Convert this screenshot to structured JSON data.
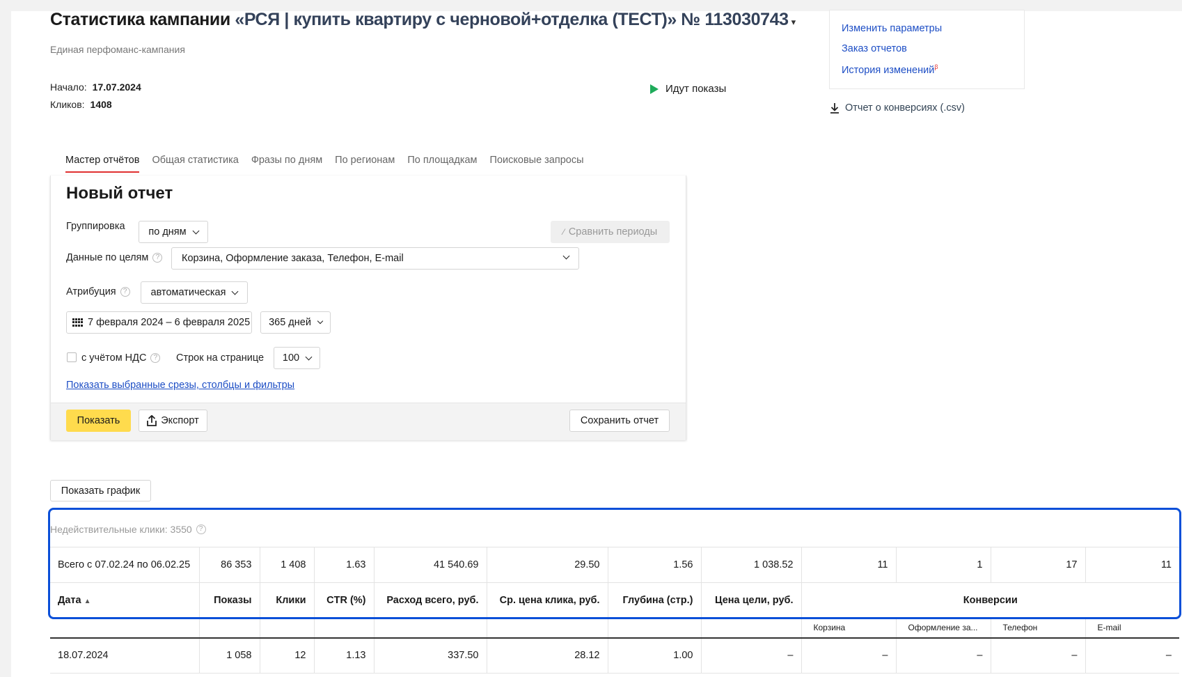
{
  "header": {
    "title_prefix": "Статистика кампании",
    "campaign_name": "«РСЯ | купить квартиру с черновой+отделка (ТЕСТ)» № 113030743",
    "caret": "▾",
    "subtitle": "Единая перфоманс-кампания",
    "start_label": "Начало:",
    "start_value": "17.07.2024",
    "clicks_label": "Кликов:",
    "clicks_value": "1408",
    "status": "Идут показы"
  },
  "side": {
    "links": [
      "Изменить параметры",
      "Заказ отчетов",
      "История изменений"
    ],
    "beta": "β",
    "csv": "Отчет о конверсиях (.csv)"
  },
  "tabs": [
    "Мастер отчётов",
    "Общая статистика",
    "Фразы по дням",
    "По регионам",
    "По площадкам",
    "Поисковые запросы"
  ],
  "report": {
    "title": "Новый отчет",
    "grouping_label": "Группировка",
    "grouping_value": "по дням",
    "compare_label": "Сравнить периоды",
    "goals_label": "Данные по целям",
    "goals_value": "Корзина, Оформление заказа, Телефон, E-mail",
    "attribution_label": "Атрибуция",
    "attribution_value": "автоматическая",
    "period_value": "7 февраля 2024 – 6 февраля 2025",
    "days_value": "365 дней",
    "vat_label": "с учётом НДС",
    "rows_label": "Строк на странице",
    "rows_value": "100",
    "show_filters_link": "Показать выбранные срезы, столбцы и фильтры",
    "show_button": "Показать",
    "export_button": "Экспорт",
    "save_button": "Сохранить отчет"
  },
  "chart_button": "Показать график",
  "invalid_clicks": "Недействительные клики: 3550",
  "table": {
    "total_row": [
      "Всего с 07.02.24 по 06.02.25",
      "86 353",
      "1 408",
      "1.63",
      "41 540.69",
      "29.50",
      "1.56",
      "1 038.52",
      "11",
      "1",
      "17",
      "11"
    ],
    "headers": [
      "Дата",
      "Показы",
      "Клики",
      "CTR (%)",
      "Расход всего, руб.",
      "Ср. цена клика, руб.",
      "Глубина (стр.)",
      "Цена цели, руб.",
      "Конверсии"
    ],
    "sort_arrow": "▲",
    "conversion_subheaders": [
      "Корзина",
      "Оформление за...",
      "Телефон",
      "E-mail"
    ],
    "rows": [
      [
        "18.07.2024",
        "1 058",
        "12",
        "1.13",
        "337.50",
        "28.12",
        "1.00",
        "–",
        "–",
        "–",
        "–",
        "–"
      ]
    ]
  }
}
